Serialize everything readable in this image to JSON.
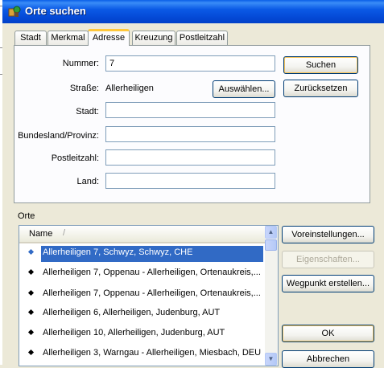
{
  "window": {
    "title": "Orte suchen",
    "icon": "app-icon"
  },
  "tabs": [
    {
      "label": "Stadt"
    },
    {
      "label": "Merkmal"
    },
    {
      "label": "Adresse"
    },
    {
      "label": "Kreuzung"
    },
    {
      "label": "Postleitzahl"
    }
  ],
  "active_tab": "Adresse",
  "form": {
    "number_label": "Nummer:",
    "number_value": "7",
    "street_label": "Straße:",
    "street_value": "Allerheiligen",
    "select_button": "Auswählen...",
    "city_label": "Stadt:",
    "city_value": "",
    "state_label": "Bundesland/Provinz:",
    "state_value": "",
    "zip_label": "Postleitzahl:",
    "zip_value": "",
    "country_label": "Land:",
    "country_value": ""
  },
  "buttons": {
    "search": "Suchen",
    "reset": "Zurücksetzen",
    "preferences": "Voreinstellungen...",
    "properties": "Eigenschaften...",
    "create_waypoint": "Wegpunkt erstellen...",
    "ok": "OK",
    "cancel": "Abbrechen"
  },
  "results": {
    "group_label": "Orte",
    "column_name": "Name",
    "sort_indicator": "/",
    "items": [
      "Allerheiligen 7, Schwyz, Schwyz, CHE",
      "Allerheiligen 7, Oppenau - Allerheiligen, Ortenaukreis,...",
      "Allerheiligen 7, Oppenau - Allerheiligen, Ortenaukreis,...",
      "Allerheiligen 6, Allerheiligen, Judenburg, AUT",
      "Allerheiligen 10, Allerheiligen, Judenburg, AUT",
      "Allerheiligen 3, Warngau - Allerheiligen, Miesbach, DEU"
    ],
    "selected_index": 0
  }
}
